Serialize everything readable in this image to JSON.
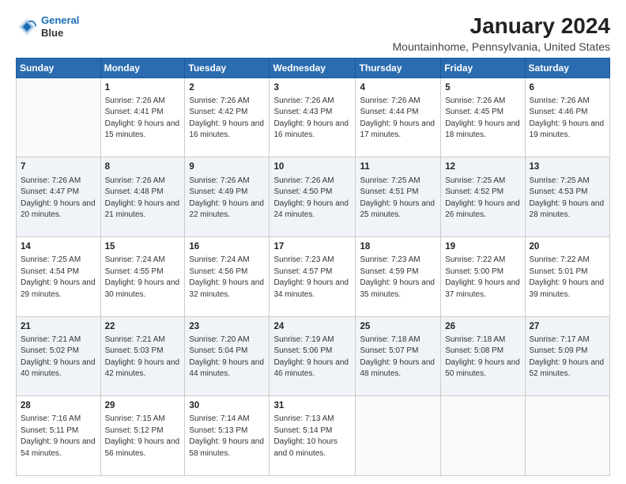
{
  "header": {
    "logo_line1": "General",
    "logo_line2": "Blue",
    "title": "January 2024",
    "subtitle": "Mountainhome, Pennsylvania, United States"
  },
  "weekdays": [
    "Sunday",
    "Monday",
    "Tuesday",
    "Wednesday",
    "Thursday",
    "Friday",
    "Saturday"
  ],
  "weeks": [
    [
      {
        "day": "",
        "info": ""
      },
      {
        "day": "1",
        "info": "Sunrise: 7:26 AM\nSunset: 4:41 PM\nDaylight: 9 hours\nand 15 minutes."
      },
      {
        "day": "2",
        "info": "Sunrise: 7:26 AM\nSunset: 4:42 PM\nDaylight: 9 hours\nand 16 minutes."
      },
      {
        "day": "3",
        "info": "Sunrise: 7:26 AM\nSunset: 4:43 PM\nDaylight: 9 hours\nand 16 minutes."
      },
      {
        "day": "4",
        "info": "Sunrise: 7:26 AM\nSunset: 4:44 PM\nDaylight: 9 hours\nand 17 minutes."
      },
      {
        "day": "5",
        "info": "Sunrise: 7:26 AM\nSunset: 4:45 PM\nDaylight: 9 hours\nand 18 minutes."
      },
      {
        "day": "6",
        "info": "Sunrise: 7:26 AM\nSunset: 4:46 PM\nDaylight: 9 hours\nand 19 minutes."
      }
    ],
    [
      {
        "day": "7",
        "info": "Sunrise: 7:26 AM\nSunset: 4:47 PM\nDaylight: 9 hours\nand 20 minutes."
      },
      {
        "day": "8",
        "info": "Sunrise: 7:26 AM\nSunset: 4:48 PM\nDaylight: 9 hours\nand 21 minutes."
      },
      {
        "day": "9",
        "info": "Sunrise: 7:26 AM\nSunset: 4:49 PM\nDaylight: 9 hours\nand 22 minutes."
      },
      {
        "day": "10",
        "info": "Sunrise: 7:26 AM\nSunset: 4:50 PM\nDaylight: 9 hours\nand 24 minutes."
      },
      {
        "day": "11",
        "info": "Sunrise: 7:25 AM\nSunset: 4:51 PM\nDaylight: 9 hours\nand 25 minutes."
      },
      {
        "day": "12",
        "info": "Sunrise: 7:25 AM\nSunset: 4:52 PM\nDaylight: 9 hours\nand 26 minutes."
      },
      {
        "day": "13",
        "info": "Sunrise: 7:25 AM\nSunset: 4:53 PM\nDaylight: 9 hours\nand 28 minutes."
      }
    ],
    [
      {
        "day": "14",
        "info": "Sunrise: 7:25 AM\nSunset: 4:54 PM\nDaylight: 9 hours\nand 29 minutes."
      },
      {
        "day": "15",
        "info": "Sunrise: 7:24 AM\nSunset: 4:55 PM\nDaylight: 9 hours\nand 30 minutes."
      },
      {
        "day": "16",
        "info": "Sunrise: 7:24 AM\nSunset: 4:56 PM\nDaylight: 9 hours\nand 32 minutes."
      },
      {
        "day": "17",
        "info": "Sunrise: 7:23 AM\nSunset: 4:57 PM\nDaylight: 9 hours\nand 34 minutes."
      },
      {
        "day": "18",
        "info": "Sunrise: 7:23 AM\nSunset: 4:59 PM\nDaylight: 9 hours\nand 35 minutes."
      },
      {
        "day": "19",
        "info": "Sunrise: 7:22 AM\nSunset: 5:00 PM\nDaylight: 9 hours\nand 37 minutes."
      },
      {
        "day": "20",
        "info": "Sunrise: 7:22 AM\nSunset: 5:01 PM\nDaylight: 9 hours\nand 39 minutes."
      }
    ],
    [
      {
        "day": "21",
        "info": "Sunrise: 7:21 AM\nSunset: 5:02 PM\nDaylight: 9 hours\nand 40 minutes."
      },
      {
        "day": "22",
        "info": "Sunrise: 7:21 AM\nSunset: 5:03 PM\nDaylight: 9 hours\nand 42 minutes."
      },
      {
        "day": "23",
        "info": "Sunrise: 7:20 AM\nSunset: 5:04 PM\nDaylight: 9 hours\nand 44 minutes."
      },
      {
        "day": "24",
        "info": "Sunrise: 7:19 AM\nSunset: 5:06 PM\nDaylight: 9 hours\nand 46 minutes."
      },
      {
        "day": "25",
        "info": "Sunrise: 7:18 AM\nSunset: 5:07 PM\nDaylight: 9 hours\nand 48 minutes."
      },
      {
        "day": "26",
        "info": "Sunrise: 7:18 AM\nSunset: 5:08 PM\nDaylight: 9 hours\nand 50 minutes."
      },
      {
        "day": "27",
        "info": "Sunrise: 7:17 AM\nSunset: 5:09 PM\nDaylight: 9 hours\nand 52 minutes."
      }
    ],
    [
      {
        "day": "28",
        "info": "Sunrise: 7:16 AM\nSunset: 5:11 PM\nDaylight: 9 hours\nand 54 minutes."
      },
      {
        "day": "29",
        "info": "Sunrise: 7:15 AM\nSunset: 5:12 PM\nDaylight: 9 hours\nand 56 minutes."
      },
      {
        "day": "30",
        "info": "Sunrise: 7:14 AM\nSunset: 5:13 PM\nDaylight: 9 hours\nand 58 minutes."
      },
      {
        "day": "31",
        "info": "Sunrise: 7:13 AM\nSunset: 5:14 PM\nDaylight: 10 hours\nand 0 minutes."
      },
      {
        "day": "",
        "info": ""
      },
      {
        "day": "",
        "info": ""
      },
      {
        "day": "",
        "info": ""
      }
    ]
  ]
}
